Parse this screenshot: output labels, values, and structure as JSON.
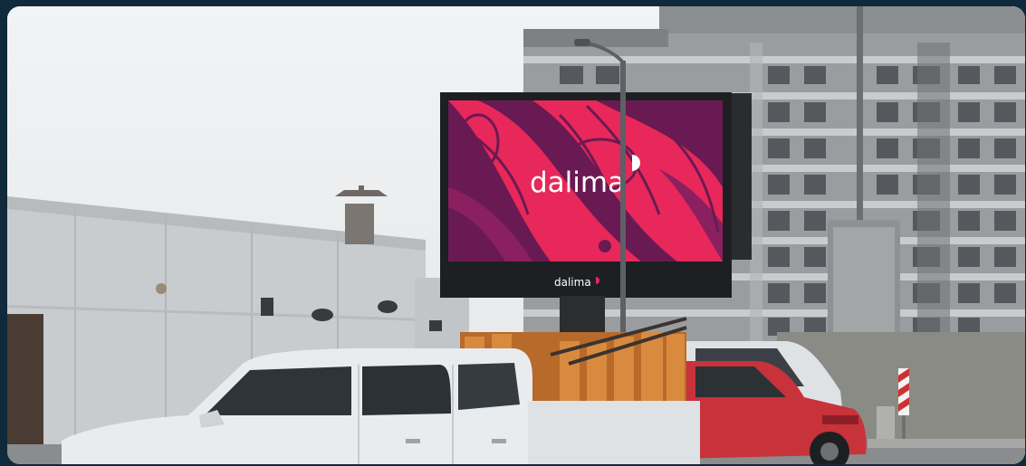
{
  "scene": {
    "screen_brand": "dalima",
    "lower_panel_brand": "dalima",
    "colors": {
      "sky": "#eceef0",
      "billboard_magenta": "#e8285a",
      "billboard_purple": "#6a1a52",
      "building_gray": "#8c8f92",
      "truck_white": "#e9ecef",
      "car_red": "#c8323a"
    }
  }
}
